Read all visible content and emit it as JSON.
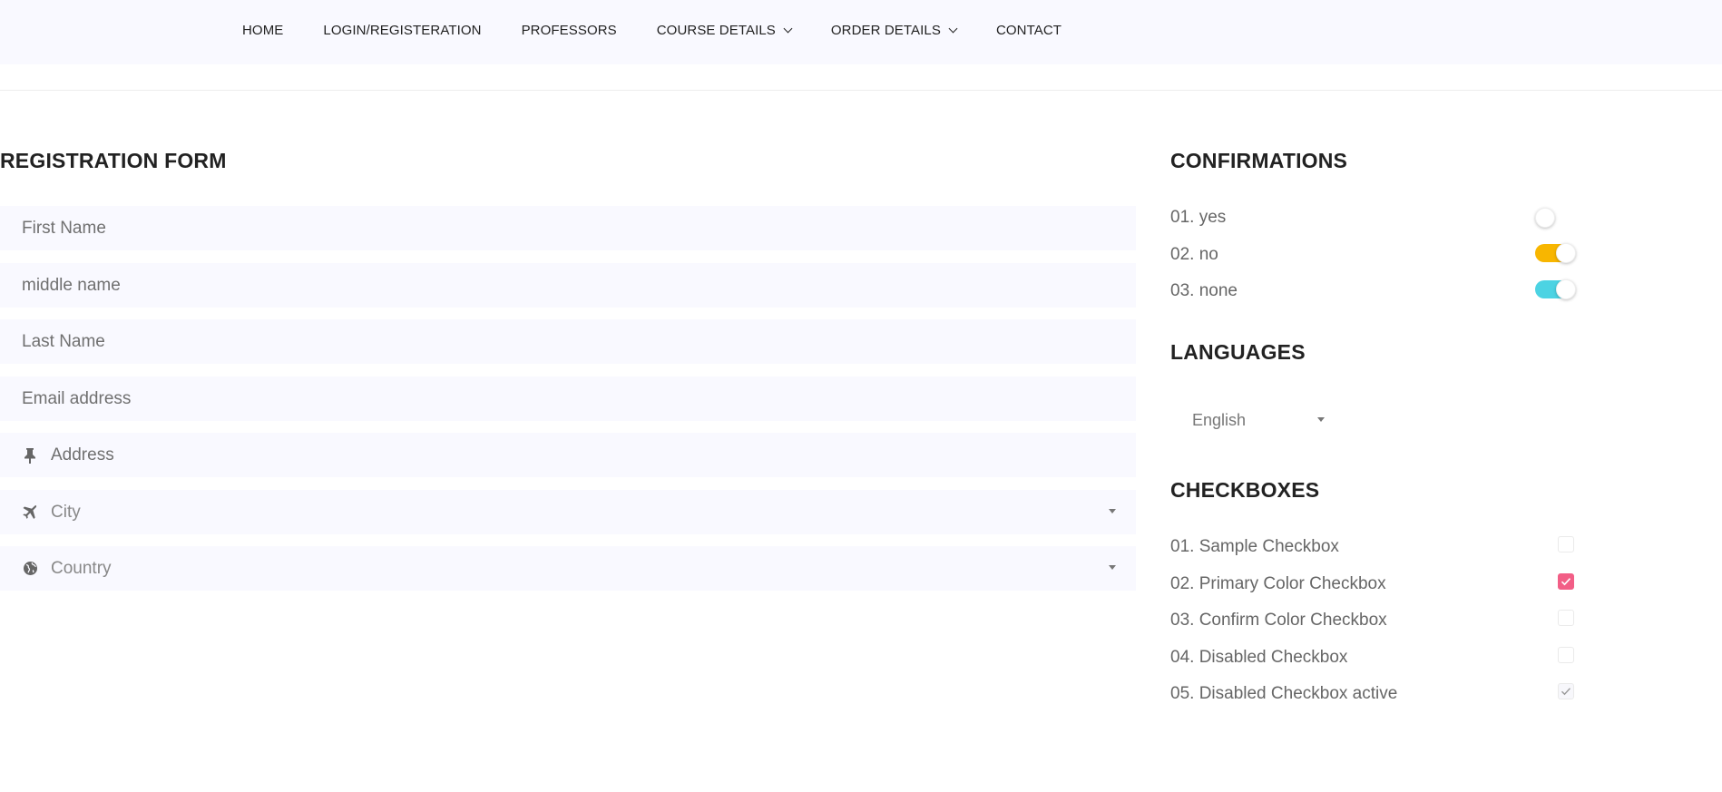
{
  "nav": {
    "items": [
      {
        "label": "HOME",
        "has_dropdown": false
      },
      {
        "label": "LOGIN/REGISTERATION",
        "has_dropdown": false
      },
      {
        "label": "PROFESSORS",
        "has_dropdown": false
      },
      {
        "label": "COURSE DETAILS",
        "has_dropdown": true
      },
      {
        "label": "ORDER DETAILS",
        "has_dropdown": true
      },
      {
        "label": "CONTACT",
        "has_dropdown": false
      }
    ]
  },
  "form": {
    "title": "REGISTRATION FORM",
    "first_name_placeholder": "First Name",
    "middle_name_placeholder": "middle name",
    "last_name_placeholder": "Last Name",
    "email_placeholder": "Email address",
    "address_placeholder": "Address",
    "city_selected": "City",
    "country_selected": "Country",
    "icons": {
      "address": "pushpin-icon",
      "city": "airplane-icon",
      "country": "globe-icon"
    }
  },
  "confirmations": {
    "title": "CONFIRMATIONS",
    "items": [
      {
        "label": "01. yes",
        "on": false,
        "color": "#ffffff"
      },
      {
        "label": "02. no",
        "on": true,
        "color": "#f8b600"
      },
      {
        "label": "03. none",
        "on": true,
        "color": "#4cd3e3"
      }
    ]
  },
  "languages": {
    "title": "LANGUAGES",
    "selected": "English"
  },
  "checkboxes": {
    "title": "CHECKBOXES",
    "items": [
      {
        "label": "01. Sample Checkbox",
        "checked": false
      },
      {
        "label": "02. Primary Color Checkbox",
        "checked": true,
        "color": "#f25e86"
      },
      {
        "label": "03. Confirm Color Checkbox",
        "checked": false
      },
      {
        "label": "04. Disabled Checkbox",
        "checked": false,
        "disabled": true
      },
      {
        "label": "05. Disabled Checkbox active",
        "checked": true,
        "disabled": true
      }
    ]
  },
  "colors": {
    "topbar_bg": "#f9f9ff",
    "field_bg": "#f9f9ff",
    "primary": "#f25e86",
    "toggle_yellow": "#f8b600",
    "toggle_cyan": "#4cd3e3"
  }
}
